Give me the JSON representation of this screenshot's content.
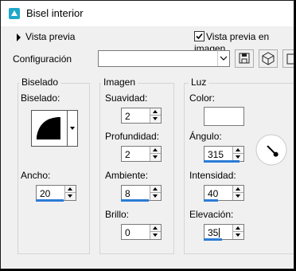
{
  "window": {
    "title": "Bisel interior"
  },
  "preview": {
    "toggle_label": "Vista previa",
    "checkbox_label": "Vista previa en imagen",
    "checked": true
  },
  "config": {
    "label": "Configuración",
    "value": ""
  },
  "toolbar": {
    "icons": [
      "save-icon",
      "cube-icon",
      "delete-icon"
    ]
  },
  "bevel_group": {
    "title": "Biselado",
    "shape_label": "Biselado:",
    "width_label": "Ancho:",
    "width_value": "20",
    "width_fill": 0.69
  },
  "image_group": {
    "title": "Imagen",
    "smoothness_label": "Suavidad:",
    "smoothness_value": "2",
    "depth_label": "Profundidad:",
    "depth_value": "2",
    "ambient_label": "Ambiente:",
    "ambient_value": "8",
    "ambient_fill": 0.69,
    "shine_label": "Brillo:",
    "shine_value": "0"
  },
  "light_group": {
    "title": "Luz",
    "color_label": "Color:",
    "color_value": "#ffffff",
    "angle_label": "Ángulo:",
    "angle_value": "315",
    "angle_fill": 0.88,
    "intensity_label": "Intensidad:",
    "intensity_value": "40",
    "intensity_fill": 0.35,
    "elevation_label": "Elevación:",
    "elevation_value": "35",
    "elevation_fill": 0.45
  },
  "colors": {
    "accent": "#2b7cd6",
    "title_icon": "#1fa8c9"
  }
}
